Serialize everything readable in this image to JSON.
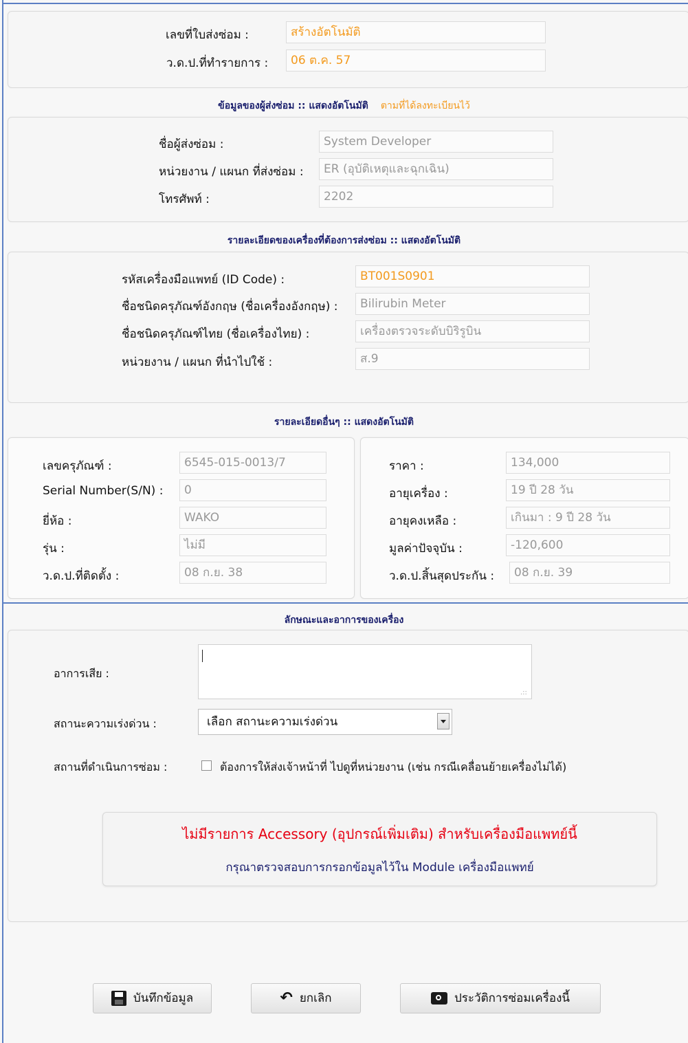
{
  "header": {
    "ticket_label": "เลขที่ใบส่งซ่อม :",
    "ticket_value": "สร้างอัตโนมัติ",
    "date_label": "ว.ด.ป.ที่ทำรายการ :",
    "date_value": "06 ต.ค. 57"
  },
  "requester": {
    "section_title": "ข้อมูลของผู้ส่งซ่อม :: แสดงอัตโนมัติ",
    "section_note": "ตามที่ได้ลงทะเบียนไว้",
    "name_label": "ชื่อผู้ส่งซ่อม :",
    "name_value": "System  Developer",
    "dept_label": "หน่วยงาน / แผนก ที่ส่งซ่อม :",
    "dept_value": "ER (อุบัติเหตุและฉุกเฉิน)",
    "phone_label": "โทรศัพท์ :",
    "phone_value": "2202"
  },
  "device": {
    "section_title": "รายละเอียดของเครื่องที่ต้องการส่งซ่อม :: แสดงอัตโนมัติ",
    "id_label": "รหัสเครื่องมือแพทย์ (ID Code) :",
    "id_value": "BT001S0901",
    "en_label": "ชื่อชนิดครุภัณฑ์อังกฤษ (ชื่อเครื่องอังกฤษ) :",
    "en_value": "Bilirubin Meter",
    "th_label": "ชื่อชนิดครุภัณฑ์ไทย (ชื่อเครื่องไทย) :",
    "th_value": "เครื่องตรวจระดับบิริรูบิน",
    "use_label": "หน่วยงาน / แผนก ที่นำไปใช้ :",
    "use_value": "ส.9"
  },
  "other": {
    "section_title": "รายละเอียดอื่นๆ :: แสดงอัตโนมัติ",
    "asset_label": "เลขครุภัณฑ์ :",
    "asset_value": "6545-015-0013/7",
    "serial_label": "Serial Number(S/N) :",
    "serial_value": "0",
    "brand_label": "ยี่ห้อ :",
    "brand_value": "WAKO",
    "model_label": "รุ่น :",
    "model_value": "ไม่มี",
    "install_label": "ว.ด.ป.ที่ติดตั้ง :",
    "install_value": "08 ก.ย. 38",
    "price_label": "ราคา :",
    "price_value": "134,000",
    "age_label": "อายุเครื่อง :",
    "age_value": "19 ปี 28 วัน",
    "remain_label": "อายุคงเหลือ :",
    "remain_value": "เกินมา : 9 ปี 28 วัน",
    "current_label": "มูลค่าปัจจุบัน :",
    "current_value": "-120,600",
    "warranty_label": "ว.ด.ป.สิ้นสุดประกัน :",
    "warranty_value": "08 ก.ย. 39"
  },
  "symptom": {
    "section_title": "ลักษณะและอาการของเครื่อง",
    "symptom_label": "อาการเสีย :",
    "symptom_value": "",
    "urgency_label": "สถานะความเร่งด่วน :",
    "urgency_selected": "เลือก สถานะความเร่งด่วน",
    "location_label": "สถานที่ดำเนินการซ่อม :",
    "location_checkbox_label": "ต้องการให้ส่งเจ้าหน้าที่ ไปดูที่หน่วยงาน (เช่น กรณีเคลื่อนย้ายเครื่องไม่ได้)"
  },
  "notice": {
    "line1": "ไม่มีรายการ Accessory (อุปกรณ์เพิ่มเติม) สำหรับเครื่องมือแพทย์นี้",
    "line2": "กรุณาตรวจสอบการกรอกข้อมูลไว้ใน Module เครื่องมือแพทย์"
  },
  "buttons": {
    "save": "บันทึกข้อมูล",
    "cancel": "ยกเลิก",
    "history": "ประวัติการซ่อมเครื่องนี้"
  },
  "colors": {
    "accent_orange": "#f39a1e",
    "title_navy": "#1a1f6d",
    "frame_blue": "#5b7fc4",
    "alert_red": "#e60012"
  }
}
